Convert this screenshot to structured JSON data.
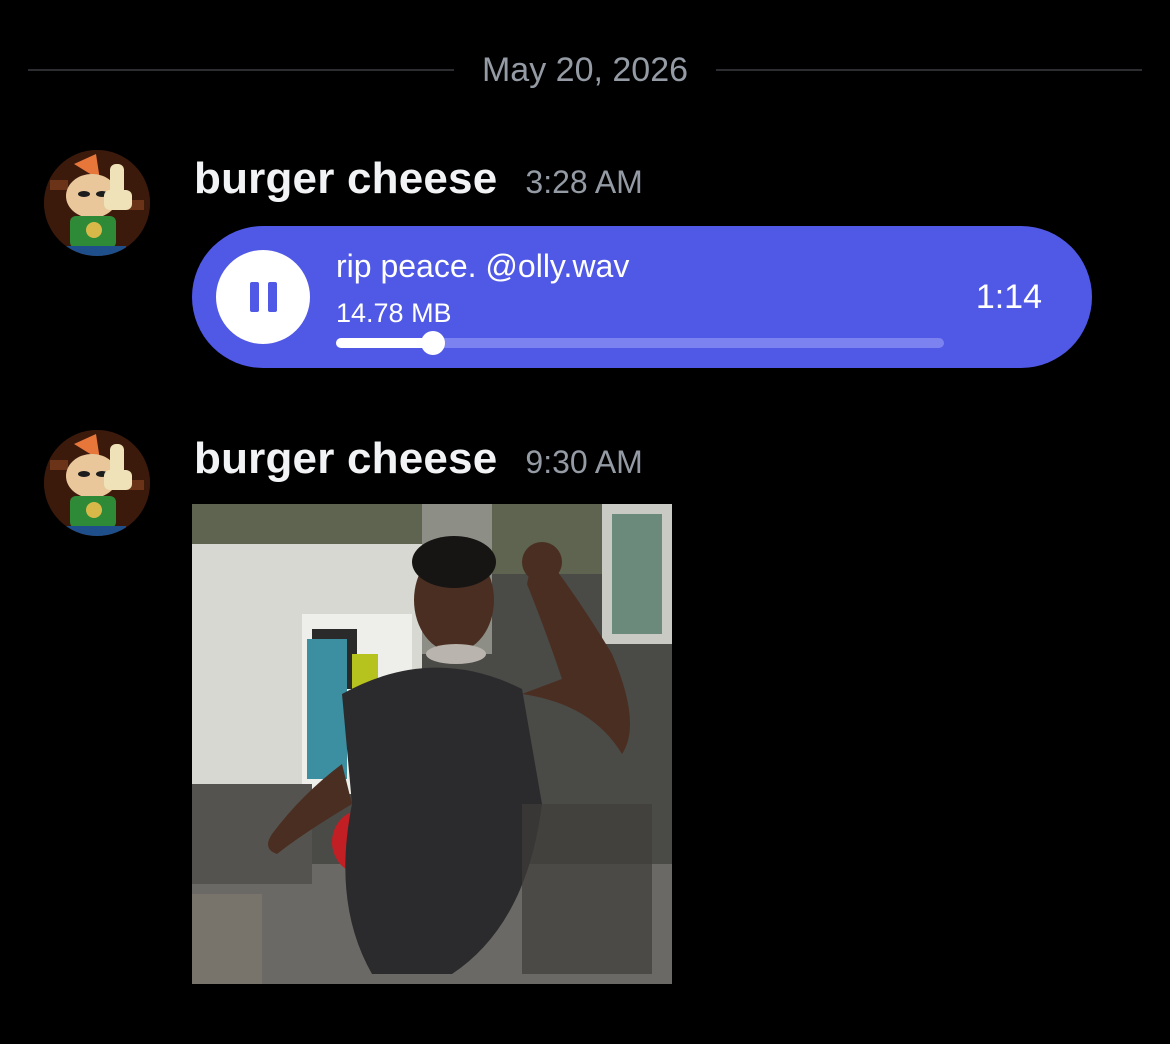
{
  "date_divider": {
    "label": "May 20, 2026"
  },
  "messages": [
    {
      "author": "burger cheese",
      "timestamp": "3:28 AM",
      "attachment": {
        "type": "audio",
        "filename": "rip peace. @olly.wav",
        "size": "14.78 MB",
        "duration": "1:14",
        "state_icon": "pause-icon",
        "progress_fraction": 0.16
      }
    },
    {
      "author": "burger cheese",
      "timestamp": "9:30 AM",
      "attachment": {
        "type": "gif"
      }
    }
  ],
  "colors": {
    "background": "#000000",
    "audio_pill": "#5058e6",
    "muted_text": "#949ba4",
    "username": "#f2f3f5"
  }
}
